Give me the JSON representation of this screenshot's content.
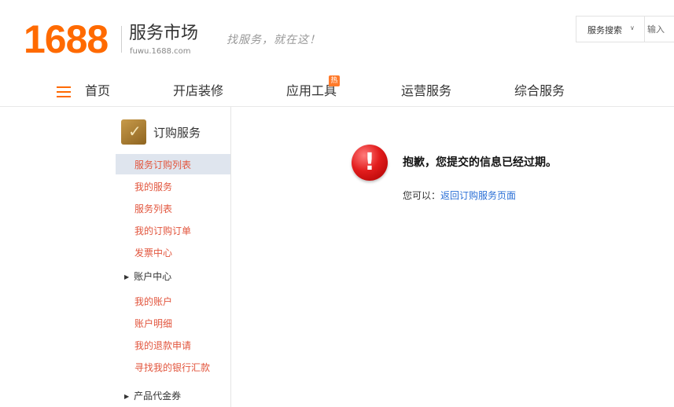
{
  "header": {
    "logo_number": "1688",
    "logo_title": "服务市场",
    "logo_domain": "fuwu.1688.com",
    "slogan": "找服务，就在这！",
    "search": {
      "type_label": "服务搜索",
      "input_placeholder": "输入"
    }
  },
  "nav": {
    "items": [
      {
        "label": "首页"
      },
      {
        "label": "开店装修"
      },
      {
        "label": "应用工具",
        "badge": "热"
      },
      {
        "label": "运营服务"
      },
      {
        "label": "综合服务"
      }
    ]
  },
  "sidebar": {
    "title": "订购服务",
    "order_links": [
      "服务订购列表",
      "我的服务",
      "服务列表",
      "我的订购订单",
      "发票中心"
    ],
    "account_section": "账户中心",
    "account_links": [
      "我的账户",
      "账户明细",
      "我的退款申请",
      "寻找我的银行汇款"
    ],
    "voucher_section": "产品代金券"
  },
  "main": {
    "error_message": "抱歉，您提交的信息已经过期。",
    "hint_label": "您可以：",
    "hint_link": "返回订购服务页面"
  },
  "colors": {
    "brand_orange": "#ff6a00",
    "link_red": "#e2553d",
    "link_blue": "#2a6fd6",
    "active_bg": "#dfe5ee"
  }
}
